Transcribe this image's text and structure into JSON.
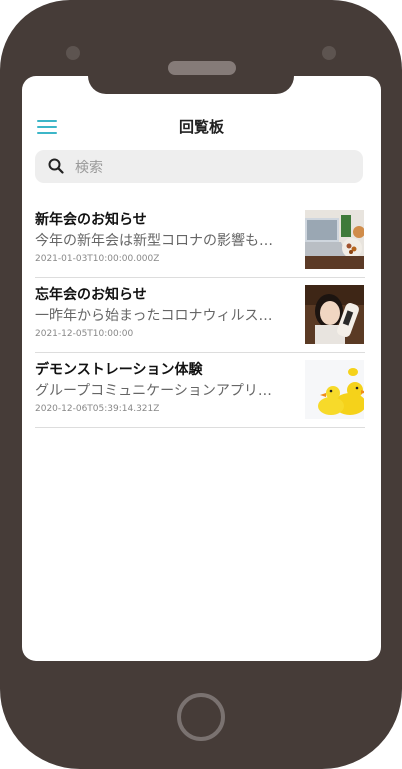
{
  "header": {
    "title": "回覧板"
  },
  "search": {
    "placeholder": "検索"
  },
  "posts": [
    {
      "title": "新年会のお知らせ",
      "summary": "今年の新年会は新型コロナの影響も…",
      "date": "2021-01-03T10:00:00.000Z",
      "thumb": "laptop-and-snacks-photo"
    },
    {
      "title": "忘年会のお知らせ",
      "summary": "一昨年から始まったコロナウィルス…",
      "date": "2021-12-05T10:00:00",
      "thumb": "woman-with-sake-bottle-photo"
    },
    {
      "title": "デモンストレーション体験",
      "summary": "グループコミュニケーションアプリ…",
      "date": "2020-12-06T05:39:14.321Z",
      "thumb": "rubber-ducks-photo"
    }
  ],
  "colors": {
    "device_frame": "#463c38",
    "accent": "#3cb6c8",
    "search_bg": "#eeeeee"
  }
}
